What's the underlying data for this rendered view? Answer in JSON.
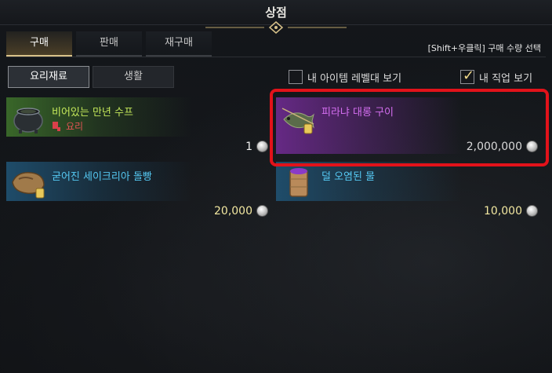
{
  "window": {
    "title": "상점"
  },
  "tabs": [
    {
      "label": "구매",
      "active": true
    },
    {
      "label": "판매",
      "active": false
    },
    {
      "label": "재구매",
      "active": false
    }
  ],
  "hint": "[Shift+우클릭] 구매 수량 선택",
  "subtabs": [
    {
      "label": "요리재료",
      "active": true
    },
    {
      "label": "생활",
      "active": false
    }
  ],
  "filters": [
    {
      "label": "내 아이템 레벨대 보기",
      "checked": false
    },
    {
      "label": "내 직업 보기",
      "checked": true
    }
  ],
  "items": [
    {
      "name": "비어있는 만년 수프",
      "sub": "요리",
      "price": "1",
      "name_color": "#c4e85a",
      "band_color": "#3b6b2a",
      "icon": "cauldron-icon"
    },
    {
      "name": "피라냐 대롱 구이",
      "sub": "",
      "price": "2,000,000",
      "name_color": "#d46ef0",
      "band_color": "#6a2a8a",
      "icon": "grilled-fish-icon"
    },
    {
      "name": "굳어진 세이크리아 돌빵",
      "sub": "",
      "price": "20,000",
      "name_color": "#55c8f2",
      "band_color": "#1f4f6e",
      "icon": "stone-bread-icon"
    },
    {
      "name": "덜 오염된 물",
      "sub": "",
      "price": "10,000",
      "name_color": "#55c8f2",
      "band_color": "#1f4f6e",
      "icon": "water-cup-icon"
    }
  ],
  "colors": {
    "accent_gold": "#d9c28a",
    "highlight_red": "#e2121a",
    "price_yellow": "#f2e7a0"
  }
}
